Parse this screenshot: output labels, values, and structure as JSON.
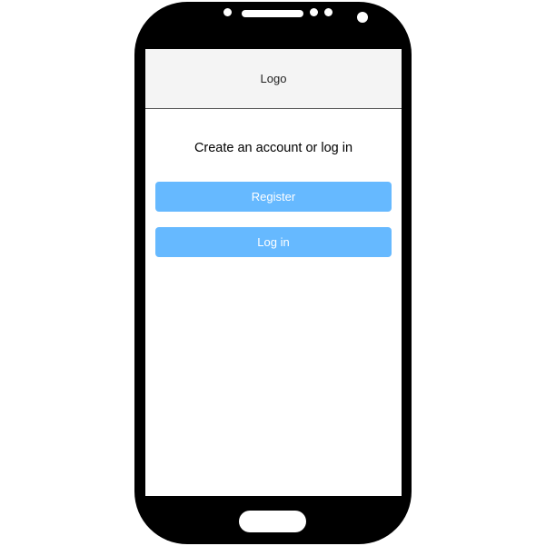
{
  "header": {
    "logo_label": "Logo"
  },
  "main": {
    "heading": "Create an account or log in",
    "register_label": "Register",
    "login_label": "Log in"
  },
  "colors": {
    "phone_frame": "#000000",
    "header_background": "#f4f4f4",
    "button_background": "#66b9ff",
    "button_text": "#ffffff"
  }
}
